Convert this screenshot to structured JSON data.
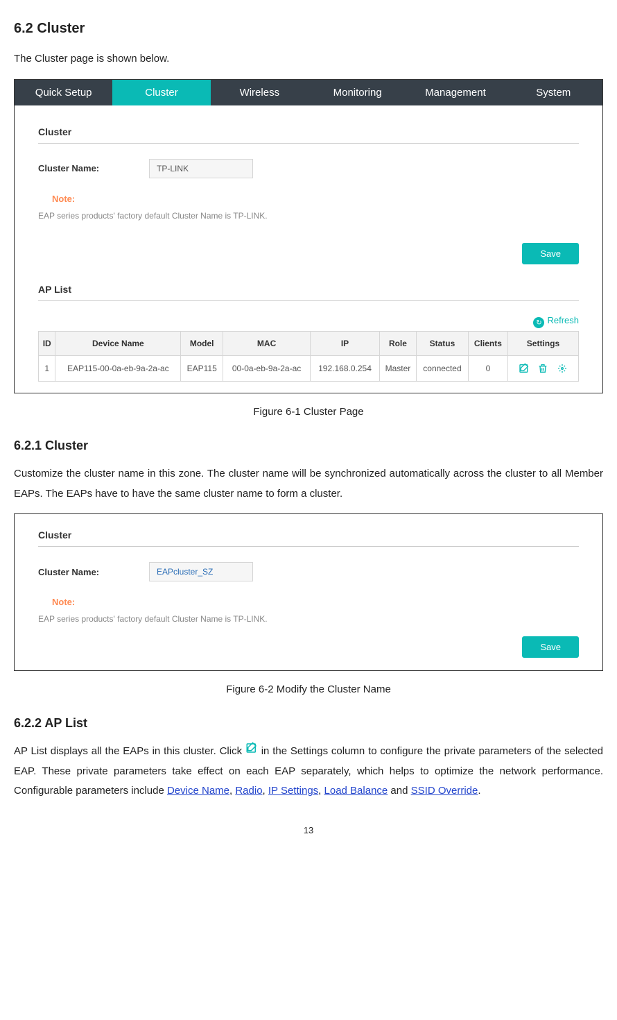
{
  "headings": {
    "h62": "6.2  Cluster",
    "h621": "6.2.1  Cluster",
    "h622": "6.2.2  AP List"
  },
  "intro62": "The Cluster page is shown below.",
  "figure1": {
    "nav": [
      "Quick Setup",
      "Cluster",
      "Wireless",
      "Monitoring",
      "Management",
      "System"
    ],
    "panel_title": "Cluster",
    "cluster_name_label": "Cluster Name:",
    "cluster_name_value": "TP-LINK",
    "note_label": "Note:",
    "note_text": "EAP series products' factory default Cluster Name is TP-LINK.",
    "save_label": "Save",
    "aplist_title": "AP List",
    "refresh_label": "Refresh",
    "columns": [
      "ID",
      "Device Name",
      "Model",
      "MAC",
      "IP",
      "Role",
      "Status",
      "Clients",
      "Settings"
    ],
    "row": {
      "id": "1",
      "device_name": "EAP115-00-0a-eb-9a-2a-ac",
      "model": "EAP115",
      "mac": "00-0a-eb-9a-2a-ac",
      "ip": "192.168.0.254",
      "role": "Master",
      "status": "connected",
      "clients": "0"
    }
  },
  "caption1": "Figure 6-1 Cluster Page",
  "body621": "Customize the cluster name in this zone. The cluster name will be synchronized automatically across the cluster to all Member EAPs. The EAPs have to have the same cluster name to form a cluster.",
  "figure2": {
    "panel_title": "Cluster",
    "cluster_name_label": "Cluster Name:",
    "cluster_name_value": "EAPcluster_SZ",
    "note_label": "Note:",
    "note_text": "EAP series products' factory default Cluster Name is TP-LINK.",
    "save_label": "Save"
  },
  "caption2": "Figure 6-2 Modify the Cluster Name",
  "body622": {
    "t1": "AP List displays all the EAPs in this cluster. Click ",
    "t2": " in the Settings column to configure the private parameters of the selected EAP. These private parameters take effect on each EAP separately, which helps to optimize the network performance. Configurable parameters include ",
    "link1": "Device Name",
    "sep1": ", ",
    "link2": "Radio",
    "sep2": ", ",
    "link3": "IP Settings",
    "sep3": ", ",
    "link4": "Load Balance",
    "sep4": " and ",
    "link5": "SSID Override",
    "end": "."
  },
  "pagenum": "13"
}
